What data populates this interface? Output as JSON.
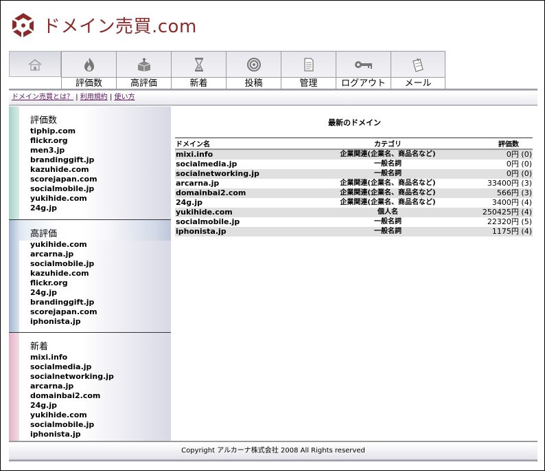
{
  "site": {
    "title": "ドメイン売買.com",
    "logo_icon": "recycle-logo-icon",
    "brand_color": "#8a2a2a"
  },
  "nav": {
    "home": {
      "icon": "home-icon"
    },
    "tabs": [
      {
        "label": "評価数",
        "icon": "flame-icon"
      },
      {
        "label": "高評価",
        "icon": "box-icon"
      },
      {
        "label": "新着",
        "icon": "hourglass-icon"
      },
      {
        "label": "投稿",
        "icon": "target-icon"
      },
      {
        "label": "管理",
        "icon": "document-icon"
      },
      {
        "label": "ログアウト",
        "icon": "key-icon"
      },
      {
        "label": "メール",
        "icon": "note-icon"
      }
    ]
  },
  "subnav": [
    {
      "label": "ドメイン売買とは？"
    },
    {
      "label": "利用規約"
    },
    {
      "label": "使い方"
    }
  ],
  "sidebar": {
    "sections": [
      {
        "title": "評価数",
        "items": [
          "tiphip.com",
          "flickr.org",
          "men3.jp",
          "brandinggift.jp",
          "kazuhide.com",
          "scorejapan.com",
          "socialmobile.jp",
          "yukihide.com",
          "24g.jp"
        ]
      },
      {
        "title": "高評価",
        "items": [
          "yukihide.com",
          "arcarna.jp",
          "socialmobile.jp",
          "kazuhide.com",
          "flickr.org",
          "24g.jp",
          "brandinggift.jp",
          "scorejapan.com",
          "iphonista.jp"
        ]
      },
      {
        "title": "新着",
        "items": [
          "mixi.info",
          "socialmedia.jp",
          "socialnetworking.jp",
          "arcarna.jp",
          "domainbai2.com",
          "24g.jp",
          "yukihide.com",
          "socialmobile.jp",
          "iphonista.jp"
        ]
      }
    ]
  },
  "main": {
    "title": "最新のドメイン",
    "columns": [
      "ドメイン名",
      "カテゴリ",
      "評価数"
    ],
    "rows": [
      {
        "domain": "mixi.info",
        "category": "企業関連(企業名、商品名など)",
        "rating": "0円 (0)"
      },
      {
        "domain": "socialmedia.jp",
        "category": "一般名詞",
        "rating": "0円 (0)"
      },
      {
        "domain": "socialnetworking.jp",
        "category": "一般名詞",
        "rating": "0円 (0)"
      },
      {
        "domain": "arcarna.jp",
        "category": "企業関連(企業名、商品名など)",
        "rating": "33400円 (3)"
      },
      {
        "domain": "domainbai2.com",
        "category": "企業関連(企業名、商品名など)",
        "rating": "566円 (3)"
      },
      {
        "domain": "24g.jp",
        "category": "企業関連(企業名、商品名など)",
        "rating": "3400円 (4)"
      },
      {
        "domain": "yukihide.com",
        "category": "個人名",
        "rating": "250425円 (4)"
      },
      {
        "domain": "socialmobile.jp",
        "category": "一般名詞",
        "rating": "22320円 (5)"
      },
      {
        "domain": "iphonista.jp",
        "category": "一般名詞",
        "rating": "1175円 (4)"
      }
    ]
  },
  "footer": {
    "copyright": "Copyright アルカーナ株式会社 2008 All Rights reserved"
  }
}
